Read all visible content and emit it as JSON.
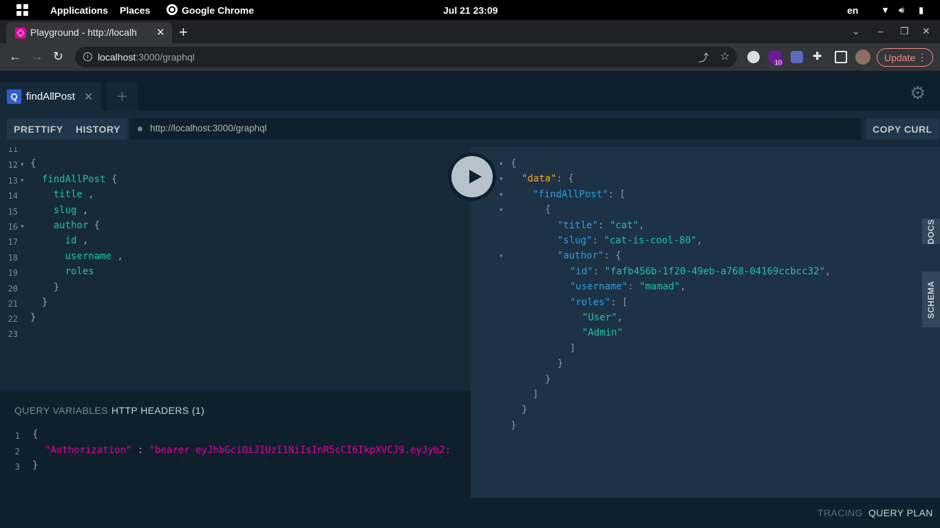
{
  "system_bar": {
    "applications": "Applications",
    "places": "Places",
    "active_app": "Google Chrome",
    "clock": "Jul 21  23:09",
    "language": "en"
  },
  "browser": {
    "tab_title": "Playground - http://localh",
    "url_host": "localhost",
    "url_rest": ":3000/graphql",
    "update_label": "Update",
    "extension_badge": "10"
  },
  "playground": {
    "tab_letter": "Q",
    "tab_name": "findAllPost",
    "buttons": {
      "prettify": "PRETTIFY",
      "history": "HISTORY",
      "copy_curl": "COPY CURL"
    },
    "endpoint": "http://localhost:3000/graphql",
    "side_tabs": {
      "docs": "DOCS",
      "schema": "SCHEMA"
    },
    "bottom_tabs": {
      "tracing": "TRACING",
      "query_plan": "QUERY PLAN"
    }
  },
  "query_editor": {
    "lines": [
      {
        "num": "11",
        "text": ""
      },
      {
        "num": "12",
        "text": "{"
      },
      {
        "num": "13",
        "text": "  findAllPost {"
      },
      {
        "num": "14",
        "text": "    title ,"
      },
      {
        "num": "15",
        "text": "    slug ,"
      },
      {
        "num": "16",
        "text": "    author {"
      },
      {
        "num": "17",
        "text": "      id ,"
      },
      {
        "num": "18",
        "text": "      username ,"
      },
      {
        "num": "19",
        "text": "      roles"
      },
      {
        "num": "20",
        "text": "    }"
      },
      {
        "num": "21",
        "text": "  }"
      },
      {
        "num": "22",
        "text": "}"
      },
      {
        "num": "23",
        "text": ""
      }
    ]
  },
  "variables_panel": {
    "tab_variables": "QUERY VARIABLES",
    "tab_headers": "HTTP HEADERS (1)",
    "lines": [
      {
        "num": "1",
        "text": "{"
      },
      {
        "num": "2",
        "key": "\"Authorization\"",
        "sep": " : ",
        "value": "\"bearer eyJhbGciOiJIUzI1NiIsInR5cCI6IkpXVCJ9.eyJyb2:"
      },
      {
        "num": "3",
        "text": "}"
      }
    ]
  },
  "result": {
    "lines": [
      "{",
      "\"data\": {",
      "\"findAllPost\": [",
      "{",
      "\"title\": \"cat\",",
      "\"slug\": \"cat-is-cool-80\",",
      "\"author\": {",
      "\"id\": \"fafb456b-1f20-49eb-a768-04169ccbcc32\",",
      "\"username\": \"mamad\",",
      "\"roles\": [",
      "\"User\",",
      "\"Admin\"",
      "]",
      "}",
      "}",
      "]",
      "}",
      "}"
    ]
  },
  "colors": {
    "background": "#172a3a",
    "field": "#22c1a0",
    "json_key": "#2f9be2",
    "data_key": "#f5a623",
    "header_key": "#e10098"
  }
}
